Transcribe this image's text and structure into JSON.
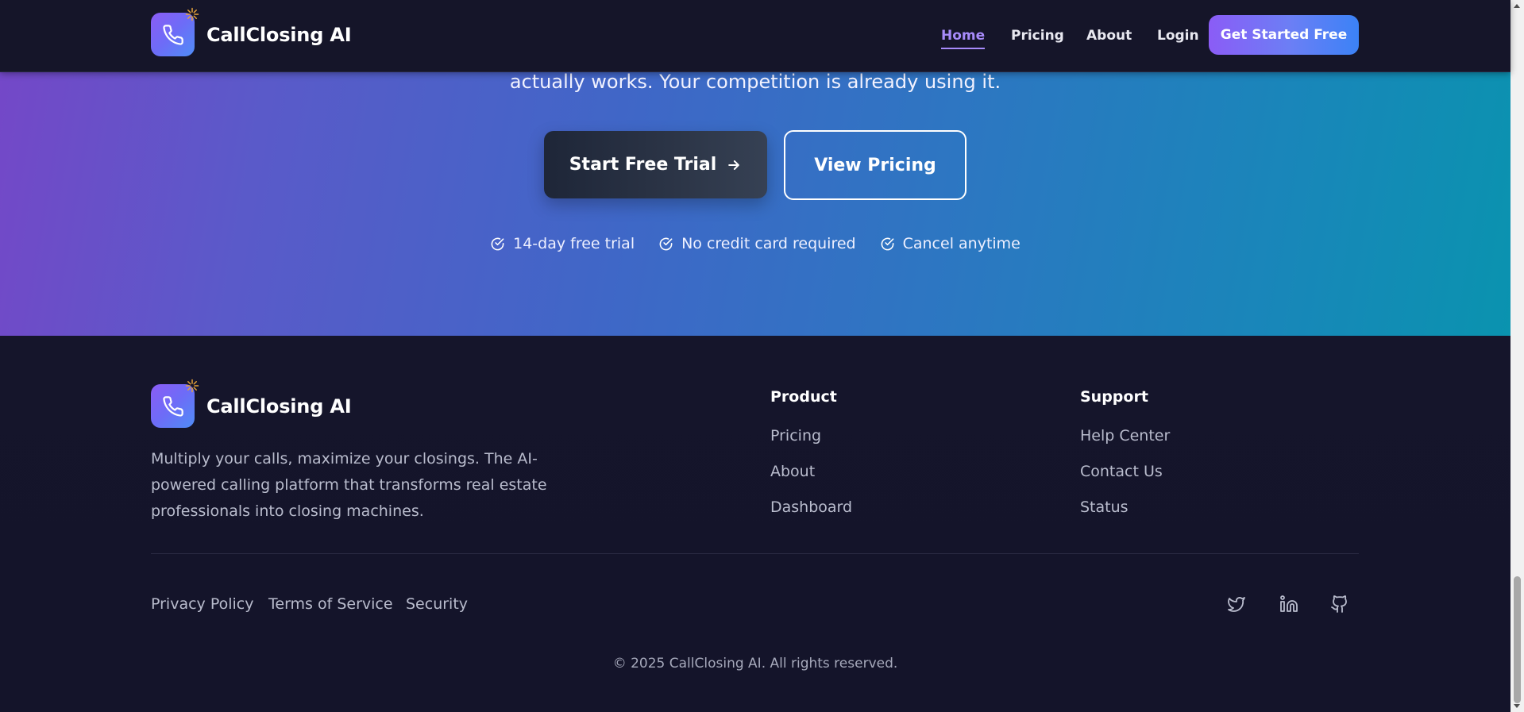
{
  "navbar": {
    "brand_name": "CallClosing AI",
    "links": [
      {
        "label": "Home",
        "active": true
      },
      {
        "label": "Pricing",
        "active": false
      },
      {
        "label": "About",
        "active": false
      },
      {
        "label": "Login",
        "active": false
      }
    ],
    "cta_label": "Get Started Free"
  },
  "hero": {
    "text_line": "actually works. Your competition is already using it.",
    "primary_button": "Start Free Trial",
    "secondary_button": "View Pricing",
    "perks": [
      "14-day free trial",
      "No credit card required",
      "Cancel anytime"
    ]
  },
  "footer": {
    "brand_name": "CallClosing AI",
    "description": "Multiply your calls, maximize your closings. The AI-powered calling platform that transforms real estate professionals into closing machines.",
    "product": {
      "title": "Product",
      "links": [
        "Pricing",
        "About",
        "Dashboard"
      ]
    },
    "support": {
      "title": "Support",
      "links": [
        "Help Center",
        "Contact Us",
        "Status"
      ]
    },
    "legal_links": [
      "Privacy Policy",
      "Terms of Service",
      "Security"
    ],
    "social_icons": [
      "twitter-icon",
      "linkedin-icon",
      "github-icon"
    ],
    "copyright": "© 2025 CallClosing AI. All rights reserved."
  },
  "colors": {
    "accent": "#8b5cf6",
    "accent_blue": "#3b82f6",
    "background": "#14142a",
    "hero_gradient_start": "#7547c8",
    "hero_gradient_end": "#0a93af"
  }
}
